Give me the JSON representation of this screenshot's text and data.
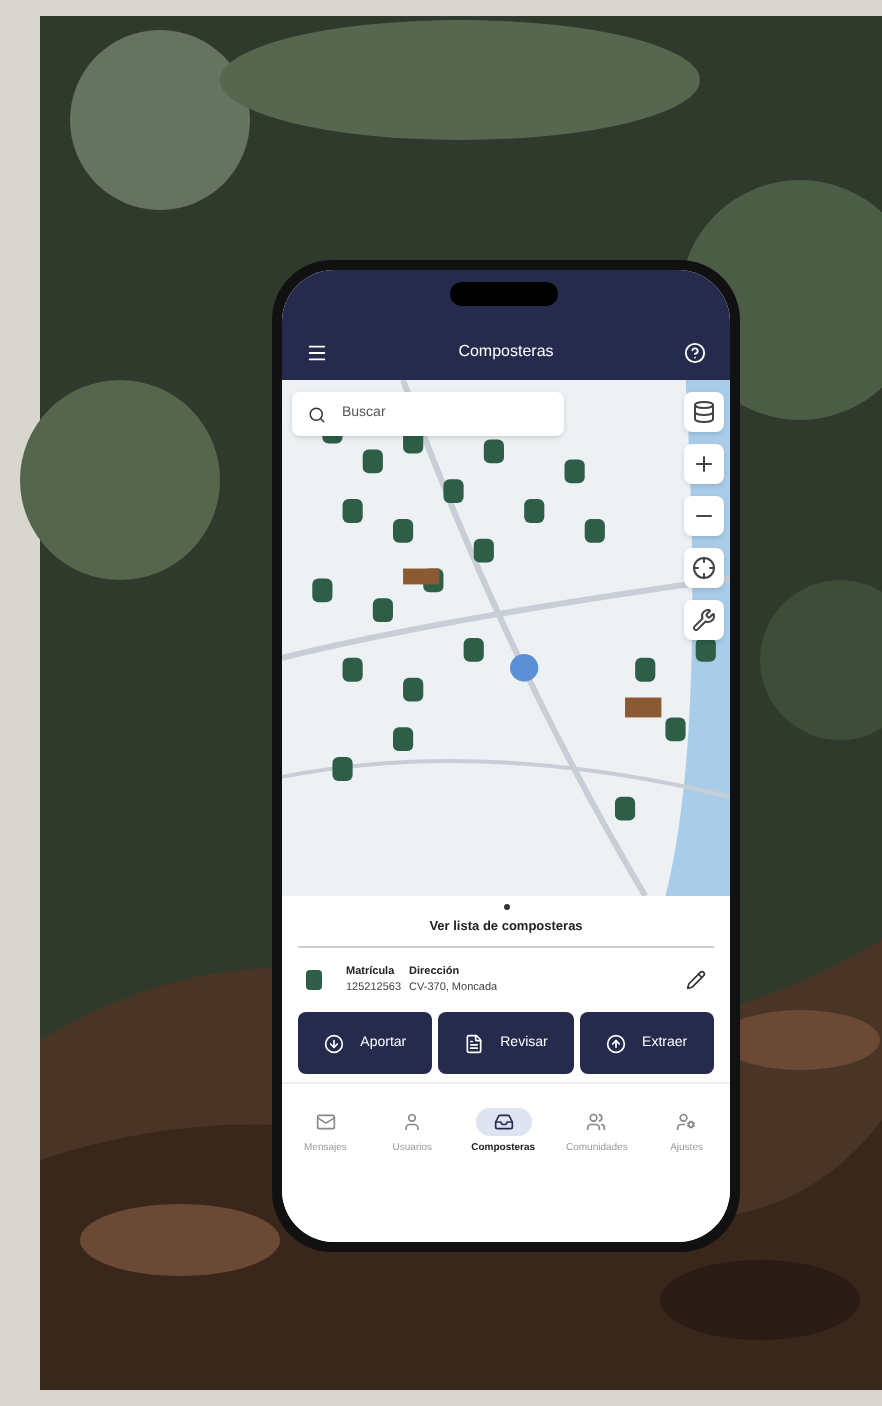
{
  "app_bar": {
    "title": "Composteras"
  },
  "search": {
    "placeholder": "Buscar"
  },
  "sheet": {
    "title": "Ver lista de composteras",
    "fields": [
      {
        "heading": "Matrícula",
        "value": "125212563"
      },
      {
        "heading": "Dirección",
        "value": "CV-370, Moncada"
      }
    ]
  },
  "actions": [
    {
      "label": "Aportar",
      "kind": "in"
    },
    {
      "label": "Revisar",
      "kind": "doc"
    },
    {
      "label": "Extraer",
      "kind": "out"
    }
  ],
  "nav": [
    {
      "label": "Mensajes",
      "kind": "mail",
      "selected": false
    },
    {
      "label": "Usuarios",
      "kind": "user",
      "selected": false
    },
    {
      "label": "Composteras",
      "kind": "bin",
      "selected": true
    },
    {
      "label": "Comunidades",
      "kind": "group",
      "selected": false
    },
    {
      "label": "Ajustes",
      "kind": "settings",
      "selected": false
    }
  ]
}
